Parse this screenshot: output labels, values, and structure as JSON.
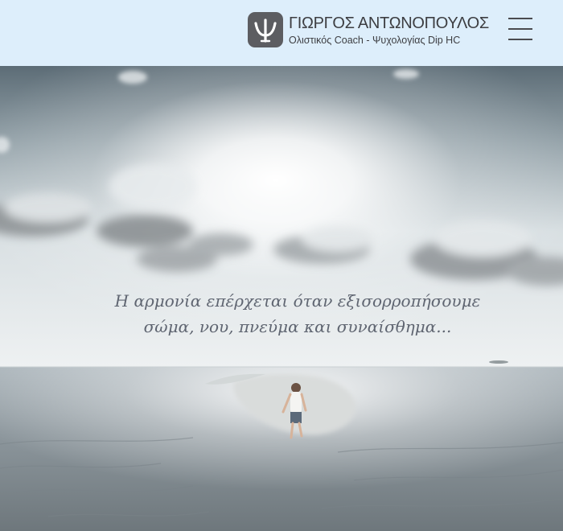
{
  "header": {
    "logo_title": "ΓΙΩΡΓΟΣ ΑΝΤΩΝΟΠΟΥΛΟΣ",
    "logo_subtitle": "Ολιστικός Coach - Ψυχολογίας Dip HC",
    "logo_icon": "psi-icon",
    "menu_icon": "hamburger-menu-icon",
    "background": "#ddeefb"
  },
  "hero": {
    "tagline_line1": "Η αρμονία επέρχεται όταν εξισορροπήσουμε",
    "tagline_line2": "σώμα, νου, πνεύμα και συναίσθημα...",
    "image": "child running on a sandbar into the sea under a bright cloudy sky"
  }
}
